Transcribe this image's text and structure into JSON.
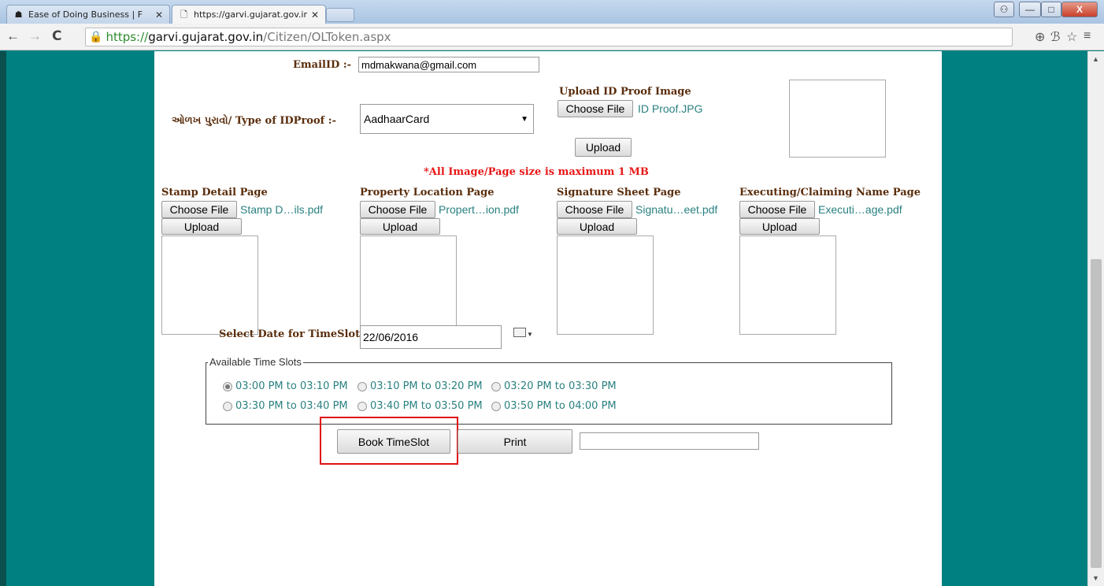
{
  "browser": {
    "tabs": [
      {
        "label": "Ease of Doing Business | F",
        "active": false
      },
      {
        "label": "https://garvi.gujarat.gov.ir",
        "active": true
      }
    ],
    "url": {
      "scheme": "https://",
      "host": "garvi.gujarat.gov.in",
      "path": "/Citizen/OLToken.aspx"
    },
    "icons": {
      "back": "←",
      "forward": "→",
      "reload": "C",
      "lock": "🔒",
      "zoom": "⊕",
      "translate": "ℬ",
      "star": "☆",
      "menu": "≡",
      "user": "👤",
      "min": "—",
      "max": "□",
      "close": "X"
    }
  },
  "form": {
    "email_label": "EmailID :-",
    "email_value": "mdmakwana@gmail.com",
    "idproof_label": "ઓળખ પુરાવો/ Type of IDProof :-",
    "idproof_value": "AadhaarCard",
    "upload_id_title": "Upload ID Proof Image",
    "choose_file": "Choose File",
    "id_file": "ID Proof.JPG",
    "upload": "Upload",
    "notice": "*All Image/Page size is maximum 1 MB",
    "docs": [
      {
        "title": "Stamp Detail Page",
        "file": "Stamp D…ils.pdf"
      },
      {
        "title": "Property Location Page",
        "file": "Propert…ion.pdf"
      },
      {
        "title": "Signature Sheet Page",
        "file": "Signatu…eet.pdf"
      },
      {
        "title": "Executing/Claiming Name Page",
        "file": "Executi…age.pdf"
      }
    ],
    "date_label": "Select Date for TimeSlot",
    "date_value": "22/06/2016",
    "slots_legend": "Available Time Slots",
    "slots": [
      {
        "label": "03:00 PM to 03:10 PM",
        "checked": true
      },
      {
        "label": "03:10 PM to 03:20 PM",
        "checked": false
      },
      {
        "label": "03:20 PM to 03:30 PM",
        "checked": false
      },
      {
        "label": "03:30 PM to 03:40 PM",
        "checked": false
      },
      {
        "label": "03:40 PM to 03:50 PM",
        "checked": false
      },
      {
        "label": "03:50 PM to 04:00 PM",
        "checked": false
      }
    ],
    "book_btn": "Book TimeSlot",
    "print_btn": "Print",
    "token_value": ""
  }
}
